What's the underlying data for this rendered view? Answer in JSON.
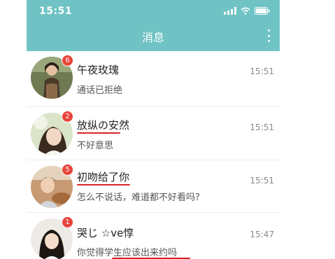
{
  "status": {
    "time": "15:51"
  },
  "header": {
    "title": "消息"
  },
  "colors": {
    "bar": "#6fc3c4",
    "badge": "#e8453c",
    "underline": "#d9232a"
  },
  "conversations": [
    {
      "name": "午夜玫瑰",
      "message": "通话已拒绝",
      "time": "15:51",
      "unread": "6"
    },
    {
      "name": "放纵の安然",
      "message": "不好意思",
      "time": "15:51",
      "unread": "2"
    },
    {
      "name": "初吻给了你",
      "message": "怎么不说话，难道都不好看吗?",
      "time": "15:51",
      "unread": "5"
    },
    {
      "name": "哭じ ☆ve惇",
      "message": "你觉得学生应该出来约吗",
      "time": "15:47",
      "unread": "1"
    }
  ]
}
